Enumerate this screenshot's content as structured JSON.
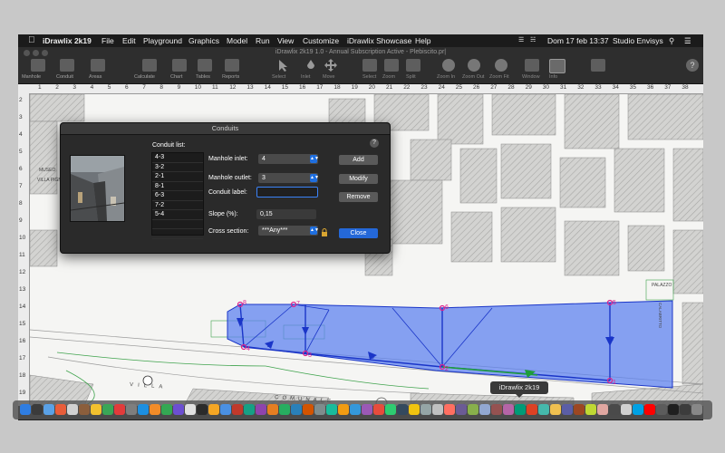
{
  "menubar": {
    "app_name": "iDrawlix 2k19",
    "items": [
      "File",
      "Edit",
      "Playground",
      "Graphics",
      "Model",
      "Run",
      "View",
      "Customize",
      "iDrawlix Showcase",
      "Help"
    ],
    "clock": "Dom 17 feb  13:37",
    "user": "Studio Envisys"
  },
  "window": {
    "title": "iDrawlix 2k19 1.0 - Annual Subscription Active - Plebiscito.pr|"
  },
  "toolbar": {
    "labels": [
      "Manhole",
      "Conduit",
      "Areas",
      "Calculate",
      "Chart",
      "Tables",
      "Reports",
      "Select",
      "Inlet",
      "Move",
      "Select",
      "Zoom",
      "Split",
      "Zoom In",
      "Zoom Out",
      "Zoom Fit",
      "Window",
      "Info"
    ]
  },
  "ruler": {
    "top": [
      "1",
      "2",
      "3",
      "4",
      "5",
      "6",
      "7",
      "8",
      "9",
      "10",
      "11",
      "12",
      "13",
      "14",
      "15",
      "16",
      "17",
      "18",
      "19",
      "20",
      "21",
      "22",
      "23",
      "24",
      "25",
      "26",
      "27",
      "28",
      "29",
      "30",
      "31",
      "32",
      "33",
      "34",
      "35",
      "36",
      "37",
      "38"
    ],
    "left": [
      "2",
      "3",
      "4",
      "5",
      "6",
      "7",
      "8",
      "9",
      "10",
      "11",
      "12",
      "13",
      "14",
      "15",
      "16",
      "17",
      "18",
      "19"
    ]
  },
  "dialog": {
    "title": "Conduits",
    "help_label": "?",
    "conduit_list_label": "Conduit list:",
    "conduits": [
      "4-3",
      "3-2",
      "2-1",
      "8-1",
      "6-3",
      "7-2",
      "5-4"
    ],
    "manhole_inlet_label": "Manhole inlet:",
    "manhole_inlet_value": "4",
    "manhole_outlet_label": "Manhole outlet:",
    "manhole_outlet_value": "3",
    "conduit_label_label": "Conduit label:",
    "conduit_label_value": "",
    "slope_label": "Slope (%):",
    "slope_value": "0,15",
    "cross_section_label": "Cross section:",
    "cross_section_value": "***Any***",
    "buttons": {
      "add": "Add",
      "modify": "Modify",
      "remove": "Remove",
      "close": "Close"
    }
  },
  "map": {
    "street_labels": [
      "VILLA",
      "COMUNALE",
      "MUSEO",
      "VILLA PIGN.",
      "PALAZZO",
      "CALABRITTO"
    ],
    "manhole_numbers": [
      "8",
      "7",
      "6",
      "5",
      "4",
      "3",
      "2",
      "1",
      "4",
      "3",
      "2"
    ],
    "colors": {
      "catchment": "#5a7ff0",
      "conduit": "#1a35c8",
      "green_conduit": "#1e9e3a",
      "manhole": "#e0208a"
    }
  },
  "dock": {
    "tooltip": "iDrawlix 2k19"
  }
}
